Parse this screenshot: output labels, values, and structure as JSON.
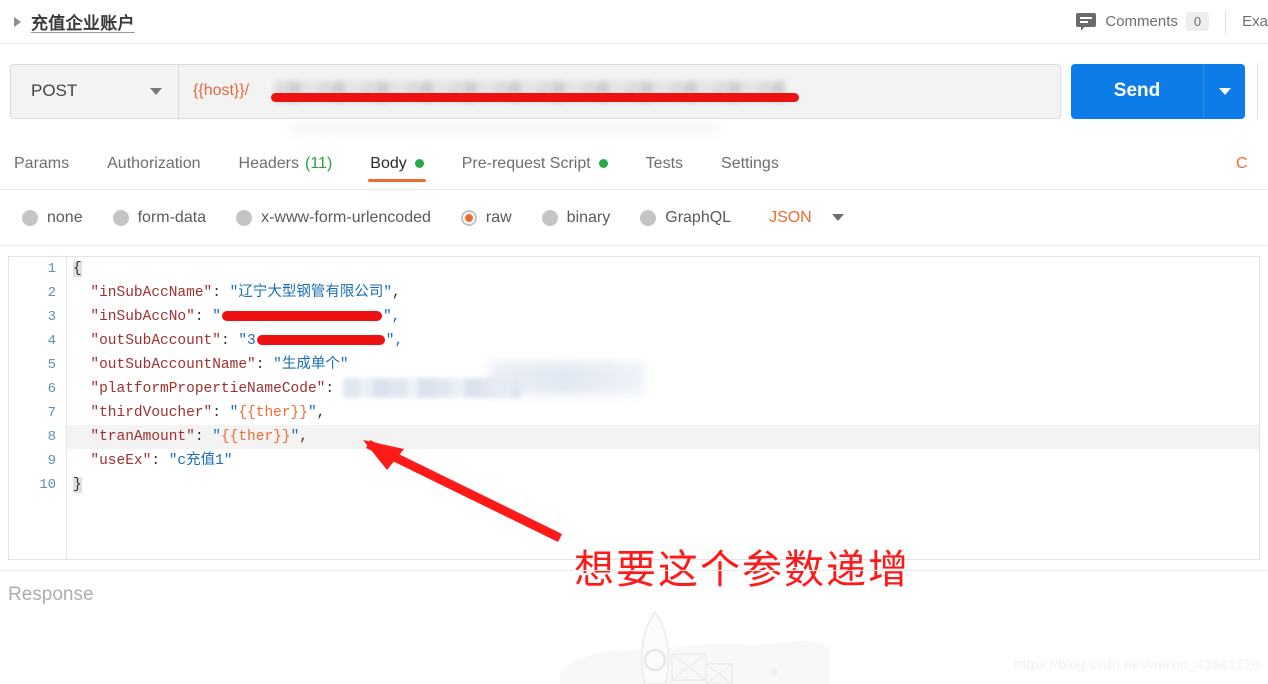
{
  "header": {
    "request_title": "充值企业账户",
    "collapse_icon": "triangle-right-icon",
    "comments_icon": "comment-bubble-icon",
    "comments_label": "Comments",
    "comments_count": "0",
    "examples_label": "Exa"
  },
  "request": {
    "method": "POST",
    "method_caret_icon": "chevron-down-icon",
    "url_prefix": "{{host}}/",
    "url_redacted": true,
    "send_label": "Send",
    "send_caret_icon": "chevron-down-icon"
  },
  "tabs": [
    {
      "label": "Params",
      "active": false,
      "count": "",
      "dot": false
    },
    {
      "label": "Authorization",
      "active": false,
      "count": "",
      "dot": false
    },
    {
      "label": "Headers",
      "active": false,
      "count": "(11)",
      "dot": false
    },
    {
      "label": "Body",
      "active": true,
      "count": "",
      "dot": true
    },
    {
      "label": "Pre-request Script",
      "active": false,
      "count": "",
      "dot": true
    },
    {
      "label": "Tests",
      "active": false,
      "count": "",
      "dot": false
    },
    {
      "label": "Settings",
      "active": false,
      "count": "",
      "dot": false
    }
  ],
  "cookies_tab": {
    "label": "C"
  },
  "body_types": [
    {
      "label": "none",
      "selected": false
    },
    {
      "label": "form-data",
      "selected": false
    },
    {
      "label": "x-www-form-urlencoded",
      "selected": false
    },
    {
      "label": "raw",
      "selected": true
    },
    {
      "label": "binary",
      "selected": false
    },
    {
      "label": "GraphQL",
      "selected": false
    }
  ],
  "format_select": {
    "label": "JSON",
    "caret_icon": "chevron-down-icon"
  },
  "editor": {
    "line_numbers": [
      "1",
      "2",
      "3",
      "4",
      "5",
      "6",
      "7",
      "8",
      "9",
      "10"
    ],
    "lines": [
      {
        "n": "1",
        "text": "{",
        "highlighted": false
      },
      {
        "n": "2",
        "key": "\"inSubAccName\"",
        "sep": ": ",
        "value": "\"辽宁大型钢管有限公司\"",
        "tail": ",",
        "highlighted": false
      },
      {
        "n": "3",
        "key": "\"inSubAccNo\"",
        "sep": ": ",
        "value": "\"",
        "redacted": true,
        "tail": "\",",
        "highlighted": false
      },
      {
        "n": "4",
        "key": "\"outSubAccount\"",
        "sep": ": ",
        "value": "\"3",
        "redacted": true,
        "tail": "\",",
        "highlighted": false
      },
      {
        "n": "5",
        "key": "\"outSubAccountName\"",
        "sep": ": ",
        "value": "\"生成单个\"",
        "tail": "",
        "highlighted": false
      },
      {
        "n": "6",
        "key": "\"platformPropertieNameCode\"",
        "sep": ": ",
        "value": "",
        "blurred": true,
        "tail": "",
        "highlighted": false
      },
      {
        "n": "7",
        "key": "\"thirdVoucher\"",
        "sep": ": ",
        "value": "{{ther}}",
        "tail": ",",
        "highlighted": false
      },
      {
        "n": "8",
        "key": "\"tranAmount\"",
        "sep": ": ",
        "value": "{{ther}}",
        "tail": ",",
        "highlighted": true
      },
      {
        "n": "9",
        "key": "\"useEx\"",
        "sep": ": ",
        "value": "\"c充值1\"",
        "tail": "",
        "highlighted": false
      },
      {
        "n": "10",
        "text": "}",
        "highlighted": false
      }
    ]
  },
  "annotation": {
    "text": "想要这个参数递增",
    "color": "#ff1a1a",
    "arrow": "red-arrow-pointing-to-tranAmount"
  },
  "response": {
    "label": "Response",
    "empty_illustration": "rocket-satellite-illustration"
  },
  "watermark": {
    "text": "https://blog.csdn.net/weixin_43881220"
  },
  "colors": {
    "accent_orange": "#ef6b33",
    "send_blue": "#0d7ce8",
    "dot_green": "#28a745",
    "annotation_red": "#ff1a1a",
    "json_key": "#a03030",
    "json_string": "#1a6fb5"
  }
}
